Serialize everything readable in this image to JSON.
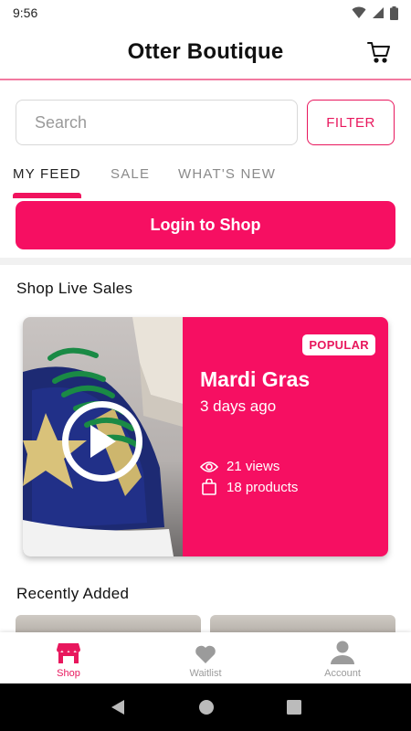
{
  "status_bar": {
    "time": "9:56"
  },
  "header": {
    "title": "Otter Boutique",
    "cart_icon": "cart-icon"
  },
  "search": {
    "placeholder": "Search",
    "filter_label": "FILTER"
  },
  "tabs": [
    {
      "label": "MY FEED",
      "active": true
    },
    {
      "label": "SALE",
      "active": false
    },
    {
      "label": "WHAT'S NEW",
      "active": false
    }
  ],
  "login": {
    "label": "Login to Shop"
  },
  "live_sales": {
    "title": "Shop Live Sales",
    "card": {
      "badge": "POPULAR",
      "name": "Mardi Gras",
      "time_ago": "3 days ago",
      "views": "21 views",
      "products": "18 products"
    }
  },
  "recently_added": {
    "title": "Recently Added"
  },
  "bottom_nav": [
    {
      "label": "Shop",
      "icon": "storefront-icon",
      "active": true
    },
    {
      "label": "Waitlist",
      "icon": "heart-icon",
      "active": false
    },
    {
      "label": "Account",
      "icon": "person-icon",
      "active": false
    }
  ],
  "colors": {
    "accent": "#f60f62",
    "accent_text": "#e8175d",
    "divider": "#f27aa1"
  }
}
